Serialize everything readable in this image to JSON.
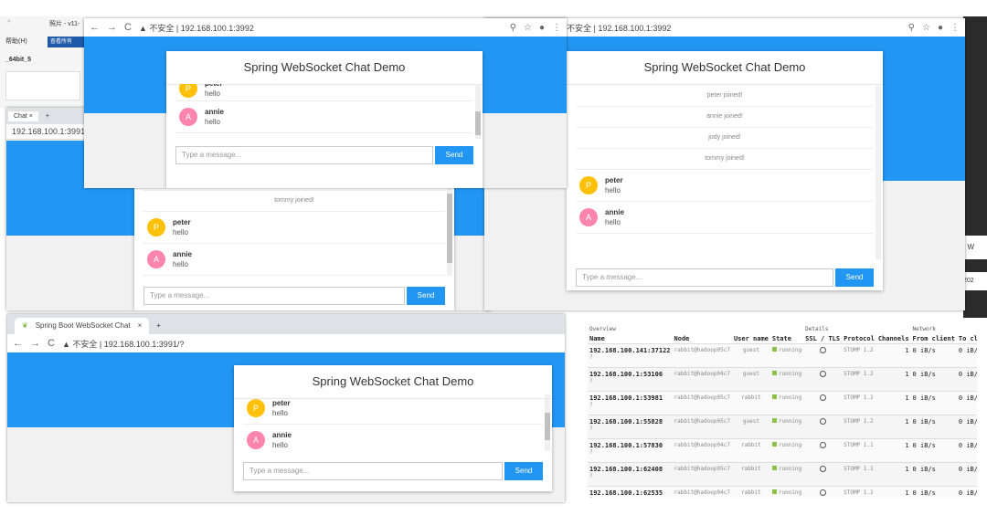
{
  "app_title": "Spring WebSocket Chat Demo",
  "send_label": "Send",
  "input_placeholder": "Type a message...",
  "messages": {
    "peter": {
      "initial": "P",
      "name": "peter",
      "text": "hello"
    },
    "annie": {
      "initial": "A",
      "name": "annie",
      "text": "hello"
    }
  },
  "events": {
    "peter_joined": "peter joined!",
    "annie_joined": "annie joined!",
    "jody_joined": "jody joined!",
    "tommy_joined": "tommy joined!"
  },
  "windows": {
    "top_left": {
      "insecure": "不安全",
      "url": "192.168.100.1:3992"
    },
    "right": {
      "insecure": "不安全",
      "url": "192.168.100.1:3992"
    },
    "middle": {
      "url": "192.168.100.1:3991/?",
      "tab_label": "Chat",
      "close": "×",
      "new_tab": "+"
    },
    "bottom": {
      "tab_label": "Spring Boot WebSocket Chat",
      "close": "×",
      "new_tab": "+",
      "insecure": "不安全",
      "url": "192.168.100.1:3991/?"
    }
  },
  "background_fragments": {
    "photo": "照片 - v11-",
    "help": "帮助(H)",
    "view_all": "查看所有",
    "file_label": "_64bit_5",
    "right_edge_1": "202",
    "right_edge_2": "t W"
  },
  "accent_color": "#2196f3",
  "avatar_colors": {
    "P": "#ffc107",
    "A": "#ff85af"
  },
  "rabbitmq": {
    "group_headers": {
      "overview": "Overview",
      "details": "Details",
      "network": "Network"
    },
    "columns": [
      "Name",
      "Node",
      "User name",
      "State",
      "SSL / TLS",
      "Protocol",
      "Channels",
      "From client",
      "To cl"
    ],
    "rows": [
      {
        "name": "192.168.100.141:37122",
        "node": "rabbit@hadoop05c7",
        "user": "guest",
        "state": "running",
        "protocol": "STOMP 1.2",
        "channels": "1",
        "from": "0 iB/s",
        "to": "0 iB/"
      },
      {
        "name": "192.168.100.1:53106",
        "node": "rabbit@hadoop04c7",
        "user": "guest",
        "state": "running",
        "protocol": "STOMP 1.2",
        "channels": "1",
        "from": "0 iB/s",
        "to": "0 iB/"
      },
      {
        "name": "192.168.100.1:53981",
        "node": "rabbit@hadoop05c7",
        "user": "rabbit",
        "state": "running",
        "protocol": "STOMP 1.1",
        "channels": "1",
        "from": "0 iB/s",
        "to": "0 iB/"
      },
      {
        "name": "192.168.100.1:55828",
        "node": "rabbit@hadoop05c7",
        "user": "guest",
        "state": "running",
        "protocol": "STOMP 1.2",
        "channels": "1",
        "from": "0 iB/s",
        "to": "0 iB/"
      },
      {
        "name": "192.168.100.1:57830",
        "node": "rabbit@hadoop04c7",
        "user": "rabbit",
        "state": "running",
        "protocol": "STOMP 1.1",
        "channels": "1",
        "from": "0 iB/s",
        "to": "0 iB/"
      },
      {
        "name": "192.168.100.1:62408",
        "node": "rabbit@hadoop05c7",
        "user": "rabbit",
        "state": "running",
        "protocol": "STOMP 1.1",
        "channels": "1",
        "from": "0 iB/s",
        "to": "0 iB/"
      },
      {
        "name": "192.168.100.1:62535",
        "node": "rabbit@hadoop04c7",
        "user": "rabbit",
        "state": "running",
        "protocol": "STOMP 1.1",
        "channels": "1",
        "from": "0 iB/s",
        "to": "0 iB/"
      }
    ]
  }
}
